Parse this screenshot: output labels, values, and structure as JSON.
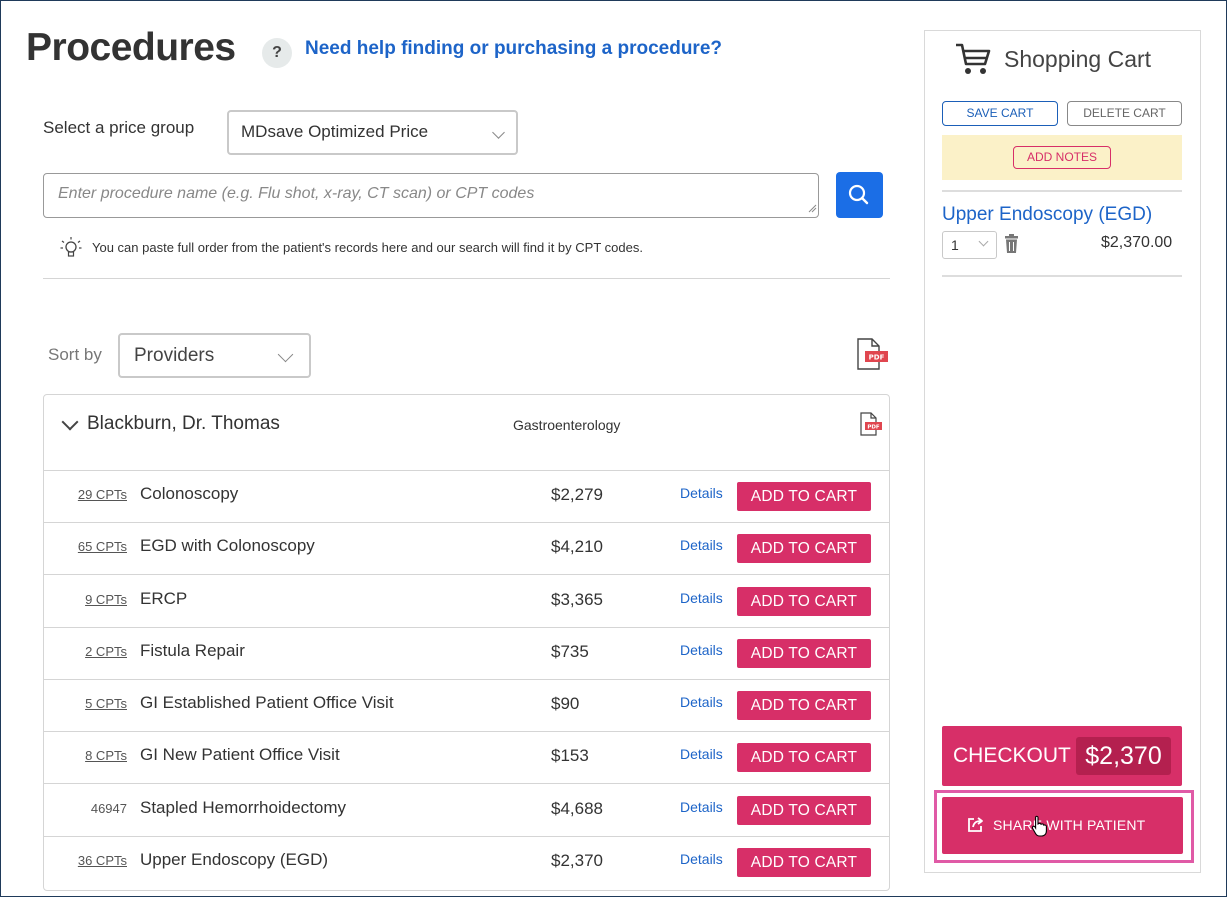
{
  "header": {
    "title": "Procedures",
    "help_icon": "?",
    "help_link": "Need help finding or purchasing a procedure?"
  },
  "price_group": {
    "label": "Select a price group",
    "selected": "MDsave Optimized Price"
  },
  "search": {
    "placeholder": "Enter procedure name (e.g. Flu shot, x-ray, CT scan) or CPT codes",
    "tip": "You can paste full order from the patient's records here and our search will find it by CPT codes."
  },
  "sort": {
    "label": "Sort by",
    "selected": "Providers"
  },
  "provider": {
    "name": "Blackburn, Dr. Thomas",
    "specialty": "Gastroenterology",
    "details_label": "Details",
    "add_label": "ADD TO CART",
    "procedures": [
      {
        "cpt": "29 CPTs",
        "cpt_link": true,
        "name": "Colonoscopy",
        "price": "$2,279"
      },
      {
        "cpt": "65 CPTs",
        "cpt_link": true,
        "name": "EGD with Colonoscopy",
        "price": "$4,210"
      },
      {
        "cpt": "9 CPTs",
        "cpt_link": true,
        "name": "ERCP",
        "price": "$3,365"
      },
      {
        "cpt": "2 CPTs",
        "cpt_link": true,
        "name": "Fistula Repair",
        "price": "$735"
      },
      {
        "cpt": "5 CPTs",
        "cpt_link": true,
        "name": "GI Established Patient Office Visit",
        "price": "$90"
      },
      {
        "cpt": "8 CPTs",
        "cpt_link": true,
        "name": "GI New Patient Office Visit",
        "price": "$153"
      },
      {
        "cpt": "46947",
        "cpt_link": false,
        "name": "Stapled Hemorrhoidectomy",
        "price": "$4,688"
      },
      {
        "cpt": "36 CPTs",
        "cpt_link": true,
        "name": "Upper Endoscopy (EGD)",
        "price": "$2,370"
      }
    ]
  },
  "cart": {
    "title": "Shopping Cart",
    "save_label": "SAVE CART",
    "delete_label": "DELETE CART",
    "notes_label": "ADD NOTES",
    "item": {
      "name": "Upper Endoscopy (EGD)",
      "qty": "1",
      "price": "$2,370.00"
    },
    "checkout_label": "CHECKOUT",
    "checkout_total": "$2,370",
    "share_label": "SHARE WITH PATIENT"
  },
  "colors": {
    "accent": "#d72f68",
    "link": "#1d64c8",
    "search_button": "#1b6ee6",
    "highlight_outline": "#e05aa6"
  }
}
